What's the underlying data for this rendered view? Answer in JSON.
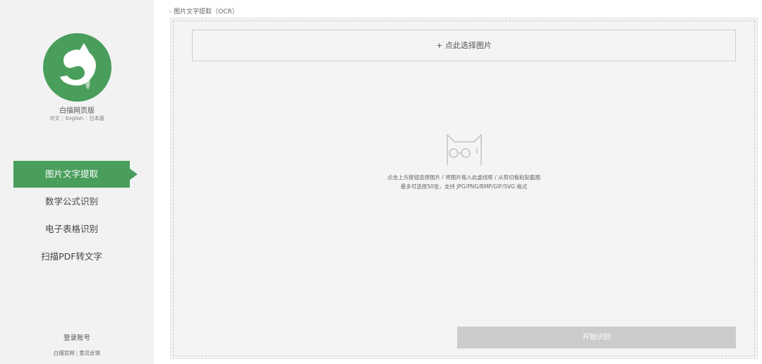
{
  "brand": {
    "name": "白描网页版",
    "logo_icon": "cat-s-logo-icon",
    "accent": "#4a9e5c"
  },
  "languages": [
    "中文",
    "English",
    "日本語"
  ],
  "nav": {
    "items": [
      {
        "label": "图片文字提取",
        "active": true
      },
      {
        "label": "数学公式识别",
        "active": false
      },
      {
        "label": "电子表格识别",
        "active": false
      },
      {
        "label": "扫描PDF转文字",
        "active": false
      }
    ]
  },
  "account": {
    "login_label": "登录账号"
  },
  "footer": {
    "links": [
      "白描官网",
      "意见反馈"
    ],
    "separator": "|"
  },
  "main": {
    "page_label": "- 图片文字提取（OCR）",
    "select_button": "+ 点此选择图片",
    "empty_icon": "cat-glasses-icon",
    "hint_line1": "点击上方按钮选择图片 / 将图片拖入此虚线框 / 从剪切板粘贴截图",
    "hint_line2": "最多可选择50张，支持 JPG/PNG/BMP/GIF/SVG 格式",
    "start_button": "开始识别",
    "start_button_color": "#cbcbcb"
  }
}
